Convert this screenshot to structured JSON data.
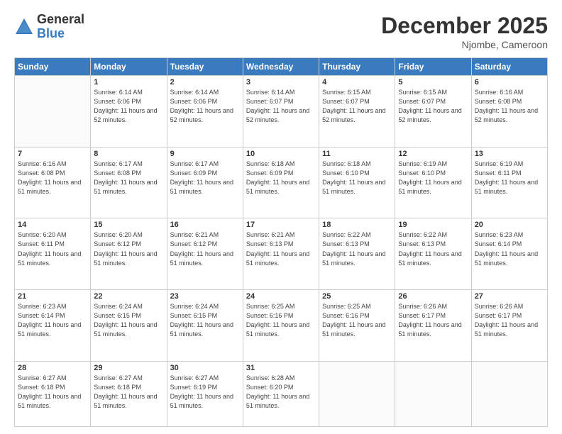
{
  "logo": {
    "general": "General",
    "blue": "Blue"
  },
  "title": "December 2025",
  "subtitle": "Njombe, Cameroon",
  "days_of_week": [
    "Sunday",
    "Monday",
    "Tuesday",
    "Wednesday",
    "Thursday",
    "Friday",
    "Saturday"
  ],
  "weeks": [
    [
      {
        "day": "",
        "sunrise": "",
        "sunset": "",
        "daylight": ""
      },
      {
        "day": "1",
        "sunrise": "Sunrise: 6:14 AM",
        "sunset": "Sunset: 6:06 PM",
        "daylight": "Daylight: 11 hours and 52 minutes."
      },
      {
        "day": "2",
        "sunrise": "Sunrise: 6:14 AM",
        "sunset": "Sunset: 6:06 PM",
        "daylight": "Daylight: 11 hours and 52 minutes."
      },
      {
        "day": "3",
        "sunrise": "Sunrise: 6:14 AM",
        "sunset": "Sunset: 6:07 PM",
        "daylight": "Daylight: 11 hours and 52 minutes."
      },
      {
        "day": "4",
        "sunrise": "Sunrise: 6:15 AM",
        "sunset": "Sunset: 6:07 PM",
        "daylight": "Daylight: 11 hours and 52 minutes."
      },
      {
        "day": "5",
        "sunrise": "Sunrise: 6:15 AM",
        "sunset": "Sunset: 6:07 PM",
        "daylight": "Daylight: 11 hours and 52 minutes."
      },
      {
        "day": "6",
        "sunrise": "Sunrise: 6:16 AM",
        "sunset": "Sunset: 6:08 PM",
        "daylight": "Daylight: 11 hours and 52 minutes."
      }
    ],
    [
      {
        "day": "7",
        "sunrise": "Sunrise: 6:16 AM",
        "sunset": "Sunset: 6:08 PM",
        "daylight": "Daylight: 11 hours and 51 minutes."
      },
      {
        "day": "8",
        "sunrise": "Sunrise: 6:17 AM",
        "sunset": "Sunset: 6:08 PM",
        "daylight": "Daylight: 11 hours and 51 minutes."
      },
      {
        "day": "9",
        "sunrise": "Sunrise: 6:17 AM",
        "sunset": "Sunset: 6:09 PM",
        "daylight": "Daylight: 11 hours and 51 minutes."
      },
      {
        "day": "10",
        "sunrise": "Sunrise: 6:18 AM",
        "sunset": "Sunset: 6:09 PM",
        "daylight": "Daylight: 11 hours and 51 minutes."
      },
      {
        "day": "11",
        "sunrise": "Sunrise: 6:18 AM",
        "sunset": "Sunset: 6:10 PM",
        "daylight": "Daylight: 11 hours and 51 minutes."
      },
      {
        "day": "12",
        "sunrise": "Sunrise: 6:19 AM",
        "sunset": "Sunset: 6:10 PM",
        "daylight": "Daylight: 11 hours and 51 minutes."
      },
      {
        "day": "13",
        "sunrise": "Sunrise: 6:19 AM",
        "sunset": "Sunset: 6:11 PM",
        "daylight": "Daylight: 11 hours and 51 minutes."
      }
    ],
    [
      {
        "day": "14",
        "sunrise": "Sunrise: 6:20 AM",
        "sunset": "Sunset: 6:11 PM",
        "daylight": "Daylight: 11 hours and 51 minutes."
      },
      {
        "day": "15",
        "sunrise": "Sunrise: 6:20 AM",
        "sunset": "Sunset: 6:12 PM",
        "daylight": "Daylight: 11 hours and 51 minutes."
      },
      {
        "day": "16",
        "sunrise": "Sunrise: 6:21 AM",
        "sunset": "Sunset: 6:12 PM",
        "daylight": "Daylight: 11 hours and 51 minutes."
      },
      {
        "day": "17",
        "sunrise": "Sunrise: 6:21 AM",
        "sunset": "Sunset: 6:13 PM",
        "daylight": "Daylight: 11 hours and 51 minutes."
      },
      {
        "day": "18",
        "sunrise": "Sunrise: 6:22 AM",
        "sunset": "Sunset: 6:13 PM",
        "daylight": "Daylight: 11 hours and 51 minutes."
      },
      {
        "day": "19",
        "sunrise": "Sunrise: 6:22 AM",
        "sunset": "Sunset: 6:13 PM",
        "daylight": "Daylight: 11 hours and 51 minutes."
      },
      {
        "day": "20",
        "sunrise": "Sunrise: 6:23 AM",
        "sunset": "Sunset: 6:14 PM",
        "daylight": "Daylight: 11 hours and 51 minutes."
      }
    ],
    [
      {
        "day": "21",
        "sunrise": "Sunrise: 6:23 AM",
        "sunset": "Sunset: 6:14 PM",
        "daylight": "Daylight: 11 hours and 51 minutes."
      },
      {
        "day": "22",
        "sunrise": "Sunrise: 6:24 AM",
        "sunset": "Sunset: 6:15 PM",
        "daylight": "Daylight: 11 hours and 51 minutes."
      },
      {
        "day": "23",
        "sunrise": "Sunrise: 6:24 AM",
        "sunset": "Sunset: 6:15 PM",
        "daylight": "Daylight: 11 hours and 51 minutes."
      },
      {
        "day": "24",
        "sunrise": "Sunrise: 6:25 AM",
        "sunset": "Sunset: 6:16 PM",
        "daylight": "Daylight: 11 hours and 51 minutes."
      },
      {
        "day": "25",
        "sunrise": "Sunrise: 6:25 AM",
        "sunset": "Sunset: 6:16 PM",
        "daylight": "Daylight: 11 hours and 51 minutes."
      },
      {
        "day": "26",
        "sunrise": "Sunrise: 6:26 AM",
        "sunset": "Sunset: 6:17 PM",
        "daylight": "Daylight: 11 hours and 51 minutes."
      },
      {
        "day": "27",
        "sunrise": "Sunrise: 6:26 AM",
        "sunset": "Sunset: 6:17 PM",
        "daylight": "Daylight: 11 hours and 51 minutes."
      }
    ],
    [
      {
        "day": "28",
        "sunrise": "Sunrise: 6:27 AM",
        "sunset": "Sunset: 6:18 PM",
        "daylight": "Daylight: 11 hours and 51 minutes."
      },
      {
        "day": "29",
        "sunrise": "Sunrise: 6:27 AM",
        "sunset": "Sunset: 6:18 PM",
        "daylight": "Daylight: 11 hours and 51 minutes."
      },
      {
        "day": "30",
        "sunrise": "Sunrise: 6:27 AM",
        "sunset": "Sunset: 6:19 PM",
        "daylight": "Daylight: 11 hours and 51 minutes."
      },
      {
        "day": "31",
        "sunrise": "Sunrise: 6:28 AM",
        "sunset": "Sunset: 6:20 PM",
        "daylight": "Daylight: 11 hours and 51 minutes."
      },
      {
        "day": "",
        "sunrise": "",
        "sunset": "",
        "daylight": ""
      },
      {
        "day": "",
        "sunrise": "",
        "sunset": "",
        "daylight": ""
      },
      {
        "day": "",
        "sunrise": "",
        "sunset": "",
        "daylight": ""
      }
    ]
  ]
}
